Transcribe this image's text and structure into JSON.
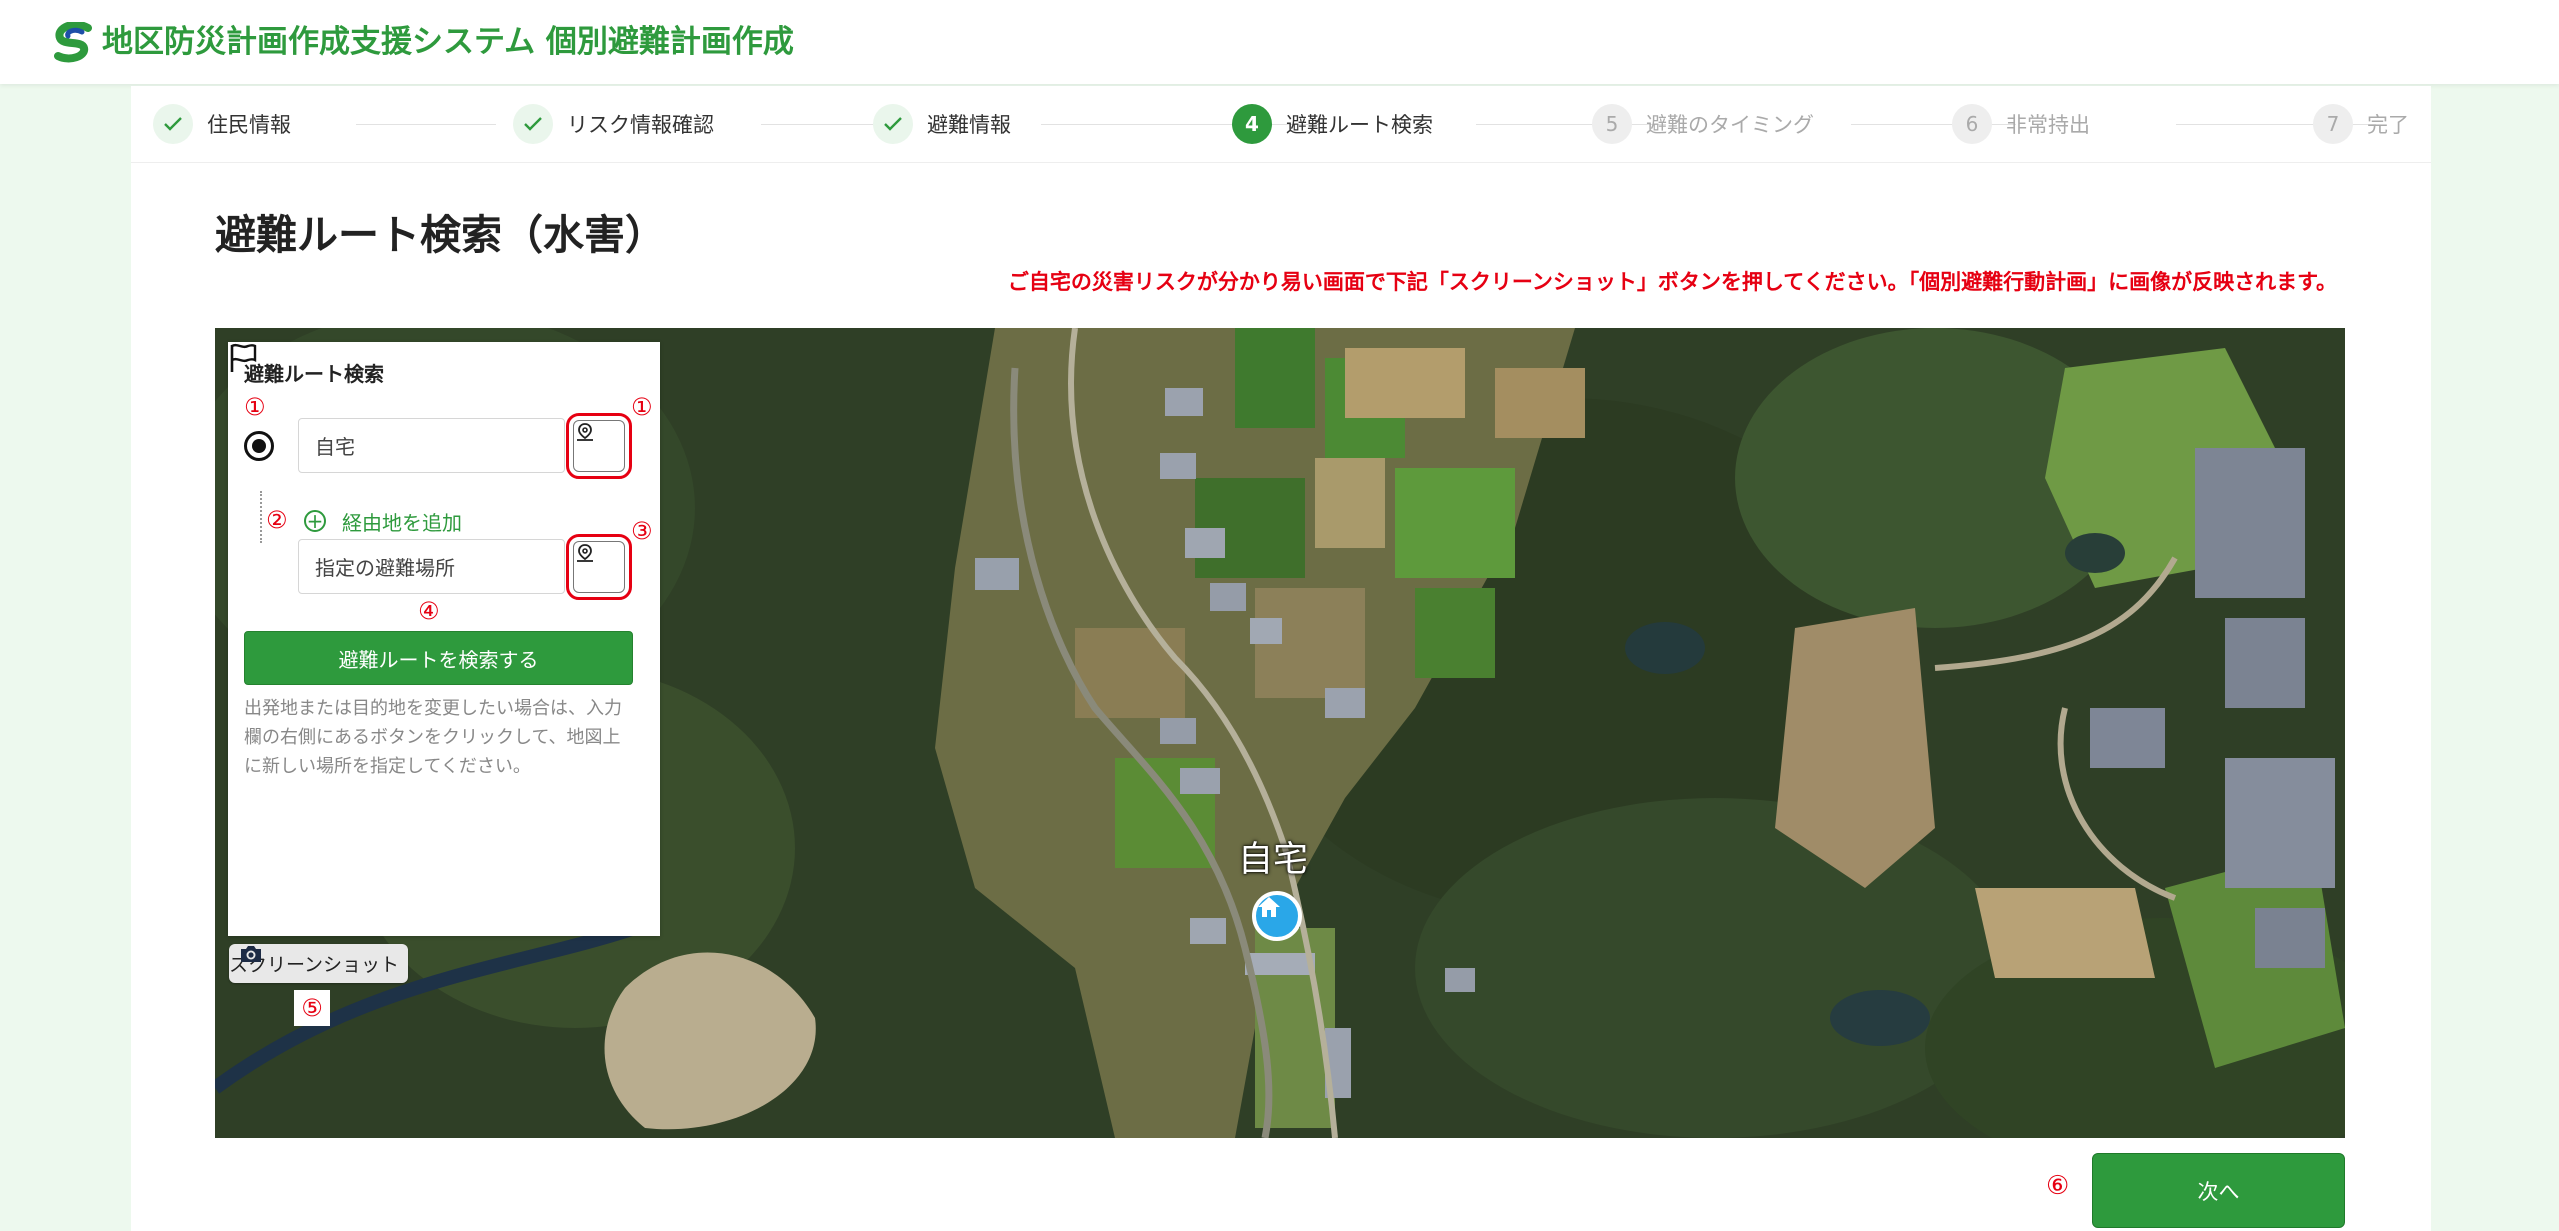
{
  "app": {
    "title": "地区防災計画作成支援システム 個別避難計画作成"
  },
  "steps": [
    {
      "number": "1",
      "label": "住民情報",
      "status": "done"
    },
    {
      "number": "2",
      "label": "リスク情報確認",
      "status": "done"
    },
    {
      "number": "3",
      "label": "避難情報",
      "status": "done"
    },
    {
      "number": "4",
      "label": "避難ルート検索",
      "status": "active"
    },
    {
      "number": "5",
      "label": "避難のタイミング",
      "status": "pending"
    },
    {
      "number": "6",
      "label": "非常持出",
      "status": "pending"
    },
    {
      "number": "7",
      "label": "完了",
      "status": "pending"
    }
  ],
  "page": {
    "title": "避難ルート検索（水害）",
    "notice": "ご自宅の災害リスクが分かり易い画面で下記「スクリーンショット」ボタンを押してください。「個別避難行動計画」に画像が反映されます。"
  },
  "search_panel": {
    "title": "避難ルート検索",
    "origin_value": "自宅",
    "add_waypoint_label": "経由地を追加",
    "destination_value": "指定の避難場所",
    "search_button_label": "避難ルートを検索する",
    "hint": "出発地または目的地を変更したい場合は、入力欄の右側にあるボタンをクリックして、地図上に新しい場所を指定してください。"
  },
  "annotations": {
    "m1": "①",
    "m2": "②",
    "m3": "③",
    "m4": "④",
    "m5": "⑤",
    "m6": "⑥"
  },
  "map": {
    "home_label": "自宅"
  },
  "screenshot_button_label": "スクリーンショット",
  "next_button_label": "次へ",
  "colors": {
    "brand_green": "#2e9a3d",
    "alert_red": "#e60012",
    "marker_blue": "#2aa7e8"
  }
}
